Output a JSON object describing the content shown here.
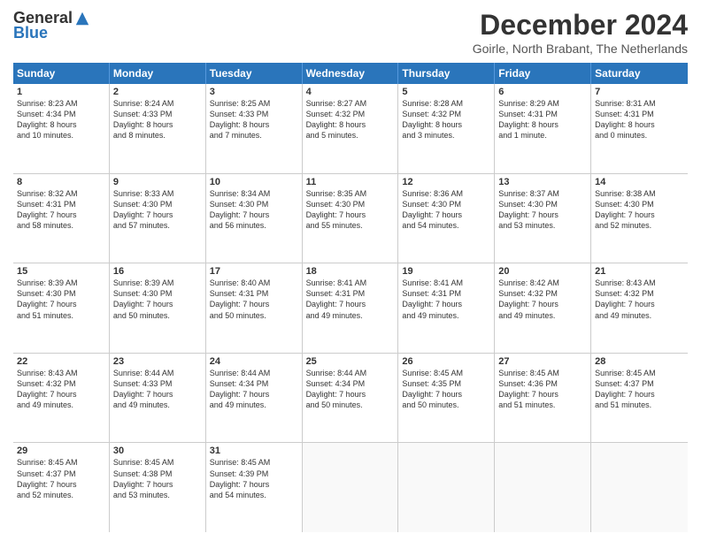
{
  "logo": {
    "general": "General",
    "blue": "Blue"
  },
  "title": "December 2024",
  "subtitle": "Goirle, North Brabant, The Netherlands",
  "header_days": [
    "Sunday",
    "Monday",
    "Tuesday",
    "Wednesday",
    "Thursday",
    "Friday",
    "Saturday"
  ],
  "weeks": [
    [
      {
        "day": "1",
        "lines": [
          "Sunrise: 8:23 AM",
          "Sunset: 4:34 PM",
          "Daylight: 8 hours",
          "and 10 minutes."
        ]
      },
      {
        "day": "2",
        "lines": [
          "Sunrise: 8:24 AM",
          "Sunset: 4:33 PM",
          "Daylight: 8 hours",
          "and 8 minutes."
        ]
      },
      {
        "day": "3",
        "lines": [
          "Sunrise: 8:25 AM",
          "Sunset: 4:33 PM",
          "Daylight: 8 hours",
          "and 7 minutes."
        ]
      },
      {
        "day": "4",
        "lines": [
          "Sunrise: 8:27 AM",
          "Sunset: 4:32 PM",
          "Daylight: 8 hours",
          "and 5 minutes."
        ]
      },
      {
        "day": "5",
        "lines": [
          "Sunrise: 8:28 AM",
          "Sunset: 4:32 PM",
          "Daylight: 8 hours",
          "and 3 minutes."
        ]
      },
      {
        "day": "6",
        "lines": [
          "Sunrise: 8:29 AM",
          "Sunset: 4:31 PM",
          "Daylight: 8 hours",
          "and 1 minute."
        ]
      },
      {
        "day": "7",
        "lines": [
          "Sunrise: 8:31 AM",
          "Sunset: 4:31 PM",
          "Daylight: 8 hours",
          "and 0 minutes."
        ]
      }
    ],
    [
      {
        "day": "8",
        "lines": [
          "Sunrise: 8:32 AM",
          "Sunset: 4:31 PM",
          "Daylight: 7 hours",
          "and 58 minutes."
        ]
      },
      {
        "day": "9",
        "lines": [
          "Sunrise: 8:33 AM",
          "Sunset: 4:30 PM",
          "Daylight: 7 hours",
          "and 57 minutes."
        ]
      },
      {
        "day": "10",
        "lines": [
          "Sunrise: 8:34 AM",
          "Sunset: 4:30 PM",
          "Daylight: 7 hours",
          "and 56 minutes."
        ]
      },
      {
        "day": "11",
        "lines": [
          "Sunrise: 8:35 AM",
          "Sunset: 4:30 PM",
          "Daylight: 7 hours",
          "and 55 minutes."
        ]
      },
      {
        "day": "12",
        "lines": [
          "Sunrise: 8:36 AM",
          "Sunset: 4:30 PM",
          "Daylight: 7 hours",
          "and 54 minutes."
        ]
      },
      {
        "day": "13",
        "lines": [
          "Sunrise: 8:37 AM",
          "Sunset: 4:30 PM",
          "Daylight: 7 hours",
          "and 53 minutes."
        ]
      },
      {
        "day": "14",
        "lines": [
          "Sunrise: 8:38 AM",
          "Sunset: 4:30 PM",
          "Daylight: 7 hours",
          "and 52 minutes."
        ]
      }
    ],
    [
      {
        "day": "15",
        "lines": [
          "Sunrise: 8:39 AM",
          "Sunset: 4:30 PM",
          "Daylight: 7 hours",
          "and 51 minutes."
        ]
      },
      {
        "day": "16",
        "lines": [
          "Sunrise: 8:39 AM",
          "Sunset: 4:30 PM",
          "Daylight: 7 hours",
          "and 50 minutes."
        ]
      },
      {
        "day": "17",
        "lines": [
          "Sunrise: 8:40 AM",
          "Sunset: 4:31 PM",
          "Daylight: 7 hours",
          "and 50 minutes."
        ]
      },
      {
        "day": "18",
        "lines": [
          "Sunrise: 8:41 AM",
          "Sunset: 4:31 PM",
          "Daylight: 7 hours",
          "and 49 minutes."
        ]
      },
      {
        "day": "19",
        "lines": [
          "Sunrise: 8:41 AM",
          "Sunset: 4:31 PM",
          "Daylight: 7 hours",
          "and 49 minutes."
        ]
      },
      {
        "day": "20",
        "lines": [
          "Sunrise: 8:42 AM",
          "Sunset: 4:32 PM",
          "Daylight: 7 hours",
          "and 49 minutes."
        ]
      },
      {
        "day": "21",
        "lines": [
          "Sunrise: 8:43 AM",
          "Sunset: 4:32 PM",
          "Daylight: 7 hours",
          "and 49 minutes."
        ]
      }
    ],
    [
      {
        "day": "22",
        "lines": [
          "Sunrise: 8:43 AM",
          "Sunset: 4:32 PM",
          "Daylight: 7 hours",
          "and 49 minutes."
        ]
      },
      {
        "day": "23",
        "lines": [
          "Sunrise: 8:44 AM",
          "Sunset: 4:33 PM",
          "Daylight: 7 hours",
          "and 49 minutes."
        ]
      },
      {
        "day": "24",
        "lines": [
          "Sunrise: 8:44 AM",
          "Sunset: 4:34 PM",
          "Daylight: 7 hours",
          "and 49 minutes."
        ]
      },
      {
        "day": "25",
        "lines": [
          "Sunrise: 8:44 AM",
          "Sunset: 4:34 PM",
          "Daylight: 7 hours",
          "and 50 minutes."
        ]
      },
      {
        "day": "26",
        "lines": [
          "Sunrise: 8:45 AM",
          "Sunset: 4:35 PM",
          "Daylight: 7 hours",
          "and 50 minutes."
        ]
      },
      {
        "day": "27",
        "lines": [
          "Sunrise: 8:45 AM",
          "Sunset: 4:36 PM",
          "Daylight: 7 hours",
          "and 51 minutes."
        ]
      },
      {
        "day": "28",
        "lines": [
          "Sunrise: 8:45 AM",
          "Sunset: 4:37 PM",
          "Daylight: 7 hours",
          "and 51 minutes."
        ]
      }
    ],
    [
      {
        "day": "29",
        "lines": [
          "Sunrise: 8:45 AM",
          "Sunset: 4:37 PM",
          "Daylight: 7 hours",
          "and 52 minutes."
        ]
      },
      {
        "day": "30",
        "lines": [
          "Sunrise: 8:45 AM",
          "Sunset: 4:38 PM",
          "Daylight: 7 hours",
          "and 53 minutes."
        ]
      },
      {
        "day": "31",
        "lines": [
          "Sunrise: 8:45 AM",
          "Sunset: 4:39 PM",
          "Daylight: 7 hours",
          "and 54 minutes."
        ]
      },
      {
        "day": "",
        "lines": []
      },
      {
        "day": "",
        "lines": []
      },
      {
        "day": "",
        "lines": []
      },
      {
        "day": "",
        "lines": []
      }
    ]
  ]
}
